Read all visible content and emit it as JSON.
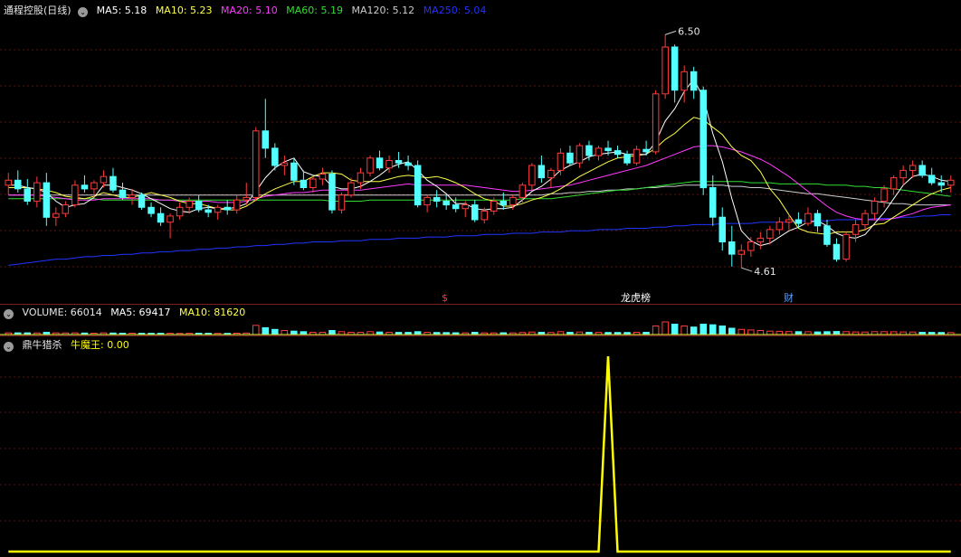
{
  "main_panel": {
    "stock_title": "通程控股(日线)",
    "ma5": "MA5: 5.18",
    "ma10": "MA10: 5.23",
    "ma20": "MA20: 5.10",
    "ma60": "MA60: 5.19",
    "ma120": "MA120: 5.12",
    "ma250": "MA250: 5.04",
    "high_label": "6.50",
    "low_label": "4.61",
    "markers": [
      {
        "text": "$",
        "color": "#ff3b3b"
      },
      {
        "text": "龙虎榜",
        "color": "#ffffff"
      },
      {
        "text": "财",
        "color": "#5aa0ff"
      }
    ]
  },
  "volume_panel": {
    "volume": "VOLUME: 66014",
    "ma5": "MA5: 69417",
    "ma10": "MA10: 81620"
  },
  "indicator_panel": {
    "name": "鼎牛猎杀",
    "line_label": "牛魔王: 0.00"
  },
  "colors": {
    "up": "#ff3b3b",
    "down": "#54ffff",
    "ma5": "#ffffff",
    "ma10": "#ffff4a",
    "ma20": "#ff3bff",
    "ma60": "#33dd33",
    "ma120": "#cccccc",
    "ma250": "#2233ff",
    "indicator": "#ffff00"
  },
  "chart_data": {
    "type": "candlestick",
    "price_range": [
      4.45,
      6.62
    ],
    "ohlc": [
      [
        5.28,
        5.38,
        5.2,
        5.32
      ],
      [
        5.32,
        5.4,
        5.22,
        5.25
      ],
      [
        5.25,
        5.33,
        5.12,
        5.15
      ],
      [
        5.15,
        5.35,
        5.1,
        5.3
      ],
      [
        5.3,
        5.38,
        4.95,
        5.02
      ],
      [
        5.02,
        5.1,
        4.95,
        5.05
      ],
      [
        5.05,
        5.15,
        5.02,
        5.12
      ],
      [
        5.12,
        5.32,
        5.1,
        5.28
      ],
      [
        5.28,
        5.36,
        5.22,
        5.25
      ],
      [
        5.25,
        5.32,
        5.18,
        5.3
      ],
      [
        5.3,
        5.4,
        5.26,
        5.35
      ],
      [
        5.35,
        5.42,
        5.22,
        5.24
      ],
      [
        5.24,
        5.3,
        5.16,
        5.18
      ],
      [
        5.18,
        5.25,
        5.12,
        5.2
      ],
      [
        5.2,
        5.22,
        5.08,
        5.1
      ],
      [
        5.1,
        5.14,
        5.02,
        5.05
      ],
      [
        5.05,
        5.1,
        4.95,
        4.98
      ],
      [
        4.98,
        5.05,
        4.85,
        5.03
      ],
      [
        5.03,
        5.14,
        5.0,
        5.1
      ],
      [
        5.1,
        5.18,
        5.05,
        5.15
      ],
      [
        5.15,
        5.2,
        5.06,
        5.08
      ],
      [
        5.08,
        5.12,
        5.02,
        5.06
      ],
      [
        5.06,
        5.12,
        5.0,
        5.1
      ],
      [
        5.1,
        5.16,
        5.04,
        5.08
      ],
      [
        5.08,
        5.2,
        5.05,
        5.16
      ],
      [
        5.16,
        5.3,
        5.12,
        5.18
      ],
      [
        5.18,
        5.75,
        5.15,
        5.72
      ],
      [
        5.72,
        5.98,
        5.5,
        5.58
      ],
      [
        5.58,
        5.62,
        5.4,
        5.44
      ],
      [
        5.44,
        5.52,
        5.36,
        5.46
      ],
      [
        5.46,
        5.5,
        5.28,
        5.32
      ],
      [
        5.32,
        5.4,
        5.24,
        5.26
      ],
      [
        5.26,
        5.35,
        5.22,
        5.33
      ],
      [
        5.33,
        5.42,
        5.28,
        5.37
      ],
      [
        5.37,
        5.4,
        5.05,
        5.08
      ],
      [
        5.08,
        5.22,
        5.05,
        5.2
      ],
      [
        5.2,
        5.34,
        5.18,
        5.3
      ],
      [
        5.3,
        5.42,
        5.25,
        5.38
      ],
      [
        5.38,
        5.52,
        5.35,
        5.5
      ],
      [
        5.5,
        5.56,
        5.4,
        5.42
      ],
      [
        5.42,
        5.52,
        5.38,
        5.48
      ],
      [
        5.48,
        5.55,
        5.42,
        5.46
      ],
      [
        5.46,
        5.52,
        5.4,
        5.44
      ],
      [
        5.44,
        5.48,
        5.1,
        5.12
      ],
      [
        5.12,
        5.2,
        5.06,
        5.18
      ],
      [
        5.18,
        5.24,
        5.1,
        5.15
      ],
      [
        5.15,
        5.2,
        5.08,
        5.12
      ],
      [
        5.12,
        5.18,
        5.06,
        5.09
      ],
      [
        5.09,
        5.15,
        5.02,
        5.12
      ],
      [
        5.12,
        5.16,
        4.98,
        5.0
      ],
      [
        5.0,
        5.1,
        4.97,
        5.07
      ],
      [
        5.07,
        5.18,
        5.04,
        5.15
      ],
      [
        5.15,
        5.22,
        5.08,
        5.12
      ],
      [
        5.12,
        5.2,
        5.08,
        5.18
      ],
      [
        5.18,
        5.3,
        5.14,
        5.28
      ],
      [
        5.28,
        5.46,
        5.24,
        5.44
      ],
      [
        5.44,
        5.52,
        5.3,
        5.34
      ],
      [
        5.34,
        5.42,
        5.26,
        5.4
      ],
      [
        5.4,
        5.58,
        5.36,
        5.54
      ],
      [
        5.54,
        5.6,
        5.44,
        5.46
      ],
      [
        5.46,
        5.62,
        5.42,
        5.6
      ],
      [
        5.6,
        5.64,
        5.48,
        5.52
      ],
      [
        5.52,
        5.6,
        5.48,
        5.58
      ],
      [
        5.58,
        5.64,
        5.52,
        5.56
      ],
      [
        5.56,
        5.6,
        5.5,
        5.53
      ],
      [
        5.53,
        5.56,
        5.44,
        5.46
      ],
      [
        5.46,
        5.6,
        5.44,
        5.57
      ],
      [
        5.57,
        5.64,
        5.52,
        5.55
      ],
      [
        5.55,
        6.05,
        5.53,
        6.02
      ],
      [
        6.02,
        6.5,
        5.98,
        6.4
      ],
      [
        6.4,
        6.42,
        5.95,
        6.05
      ],
      [
        6.05,
        6.25,
        5.95,
        6.2
      ],
      [
        6.2,
        6.24,
        5.98,
        6.05
      ],
      [
        6.05,
        6.08,
        5.2,
        5.26
      ],
      [
        5.26,
        5.36,
        4.95,
        5.02
      ],
      [
        5.02,
        5.1,
        4.75,
        4.82
      ],
      [
        4.82,
        4.95,
        4.62,
        4.72
      ],
      [
        4.72,
        4.8,
        4.61,
        4.75
      ],
      [
        4.75,
        4.86,
        4.7,
        4.82
      ],
      [
        4.82,
        4.9,
        4.76,
        4.85
      ],
      [
        4.85,
        4.95,
        4.8,
        4.92
      ],
      [
        4.92,
        5.02,
        4.88,
        4.98
      ],
      [
        4.98,
        5.04,
        4.92,
        5.0
      ],
      [
        5.0,
        5.06,
        4.94,
        4.97
      ],
      [
        4.97,
        5.1,
        4.95,
        5.05
      ],
      [
        5.05,
        5.08,
        4.9,
        4.95
      ],
      [
        4.95,
        5.0,
        4.78,
        4.8
      ],
      [
        4.8,
        4.85,
        4.66,
        4.68
      ],
      [
        4.68,
        4.9,
        4.66,
        4.88
      ],
      [
        4.88,
        5.0,
        4.82,
        4.96
      ],
      [
        4.96,
        5.08,
        4.92,
        5.05
      ],
      [
        5.05,
        5.18,
        5.0,
        5.15
      ],
      [
        5.15,
        5.28,
        5.1,
        5.25
      ],
      [
        5.25,
        5.36,
        5.2,
        5.34
      ],
      [
        5.34,
        5.44,
        5.28,
        5.4
      ],
      [
        5.4,
        5.48,
        5.34,
        5.44
      ],
      [
        5.44,
        5.48,
        5.34,
        5.36
      ],
      [
        5.36,
        5.42,
        5.28,
        5.3
      ],
      [
        5.3,
        5.36,
        5.22,
        5.28
      ],
      [
        5.28,
        5.36,
        5.22,
        5.32
      ]
    ],
    "ma5": [
      5.28,
      5.28,
      5.26,
      5.25,
      5.22,
      5.15,
      5.1,
      5.12,
      5.13,
      5.18,
      5.28,
      5.28,
      5.26,
      5.24,
      5.21,
      5.17,
      5.13,
      5.09,
      5.07,
      5.06,
      5.09,
      5.1,
      5.09,
      5.09,
      5.1,
      5.13,
      5.23,
      5.34,
      5.42,
      5.47,
      5.5,
      5.39,
      5.36,
      5.35,
      5.27,
      5.25,
      5.25,
      5.27,
      5.31,
      5.36,
      5.42,
      5.45,
      5.47,
      5.4,
      5.32,
      5.27,
      5.21,
      5.13,
      5.13,
      5.09,
      5.08,
      5.09,
      5.09,
      5.1,
      5.16,
      5.23,
      5.27,
      5.33,
      5.4,
      5.44,
      5.47,
      5.51,
      5.53,
      5.54,
      5.55,
      5.53,
      5.53,
      5.53,
      5.63,
      5.8,
      5.9,
      6.04,
      6.14,
      5.99,
      5.7,
      5.47,
      5.17,
      4.91,
      4.83,
      4.79,
      4.81,
      4.86,
      4.91,
      4.94,
      4.98,
      4.99,
      4.95,
      4.89,
      4.86,
      4.85,
      4.88,
      4.97,
      5.06,
      5.17,
      5.28,
      5.35,
      5.37,
      5.35,
      5.32,
      5.31
    ],
    "ma10": [
      5.26,
      5.26,
      5.26,
      5.25,
      5.24,
      5.22,
      5.19,
      5.18,
      5.17,
      5.19,
      5.22,
      5.2,
      5.18,
      5.18,
      5.2,
      5.22,
      5.2,
      5.18,
      5.15,
      5.13,
      5.13,
      5.11,
      5.09,
      5.08,
      5.08,
      5.11,
      5.16,
      5.21,
      5.25,
      5.28,
      5.31,
      5.31,
      5.35,
      5.38,
      5.38,
      5.37,
      5.32,
      5.31,
      5.31,
      5.31,
      5.33,
      5.35,
      5.36,
      5.35,
      5.34,
      5.35,
      5.33,
      5.3,
      5.26,
      5.21,
      5.17,
      5.15,
      5.11,
      5.11,
      5.13,
      5.16,
      5.18,
      5.21,
      5.25,
      5.3,
      5.35,
      5.39,
      5.43,
      5.47,
      5.5,
      5.51,
      5.52,
      5.53,
      5.58,
      5.65,
      5.7,
      5.77,
      5.83,
      5.81,
      5.75,
      5.69,
      5.59,
      5.52,
      5.48,
      5.39,
      5.25,
      5.16,
      5.04,
      4.93,
      4.9,
      4.89,
      4.88,
      4.9,
      4.9,
      4.9,
      4.92,
      4.96,
      4.97,
      5.02,
      5.07,
      5.12,
      5.17,
      5.21,
      5.24,
      5.26
    ],
    "ma20": [
      5.2,
      5.2,
      5.2,
      5.2,
      5.19,
      5.18,
      5.17,
      5.16,
      5.16,
      5.16,
      5.17,
      5.17,
      5.17,
      5.17,
      5.17,
      5.17,
      5.16,
      5.16,
      5.15,
      5.15,
      5.15,
      5.15,
      5.14,
      5.14,
      5.14,
      5.15,
      5.17,
      5.19,
      5.2,
      5.21,
      5.22,
      5.22,
      5.23,
      5.24,
      5.24,
      5.24,
      5.24,
      5.24,
      5.25,
      5.26,
      5.27,
      5.28,
      5.29,
      5.28,
      5.28,
      5.28,
      5.28,
      5.28,
      5.28,
      5.27,
      5.26,
      5.25,
      5.24,
      5.23,
      5.23,
      5.24,
      5.25,
      5.26,
      5.27,
      5.28,
      5.3,
      5.32,
      5.34,
      5.36,
      5.38,
      5.4,
      5.42,
      5.44,
      5.47,
      5.5,
      5.53,
      5.56,
      5.59,
      5.6,
      5.6,
      5.59,
      5.57,
      5.55,
      5.52,
      5.49,
      5.45,
      5.4,
      5.35,
      5.29,
      5.23,
      5.17,
      5.11,
      5.06,
      5.03,
      5.01,
      5.0,
      5.0,
      5.0,
      5.01,
      5.03,
      5.05,
      5.08,
      5.1,
      5.11,
      5.12
    ],
    "ma60": [
      5.17,
      5.17,
      5.17,
      5.17,
      5.17,
      5.17,
      5.17,
      5.17,
      5.17,
      5.17,
      5.16,
      5.16,
      5.16,
      5.16,
      5.16,
      5.16,
      5.16,
      5.16,
      5.16,
      5.16,
      5.16,
      5.16,
      5.16,
      5.16,
      5.16,
      5.16,
      5.16,
      5.16,
      5.16,
      5.16,
      5.16,
      5.16,
      5.16,
      5.16,
      5.15,
      5.15,
      5.15,
      5.15,
      5.16,
      5.16,
      5.16,
      5.16,
      5.16,
      5.16,
      5.16,
      5.16,
      5.16,
      5.16,
      5.16,
      5.16,
      5.16,
      5.16,
      5.16,
      5.16,
      5.17,
      5.17,
      5.17,
      5.17,
      5.18,
      5.19,
      5.2,
      5.21,
      5.22,
      5.23,
      5.24,
      5.24,
      5.25,
      5.26,
      5.27,
      5.28,
      5.29,
      5.3,
      5.31,
      5.31,
      5.31,
      5.31,
      5.31,
      5.31,
      5.3,
      5.3,
      5.3,
      5.29,
      5.29,
      5.29,
      5.29,
      5.29,
      5.28,
      5.28,
      5.28,
      5.27,
      5.27,
      5.26,
      5.26,
      5.25,
      5.24,
      5.23,
      5.22,
      5.21,
      5.2,
      5.19
    ],
    "ma120": [
      5.2,
      5.2,
      5.2,
      5.2,
      5.2,
      5.2,
      5.2,
      5.2,
      5.2,
      5.2,
      5.2,
      5.2,
      5.2,
      5.2,
      5.2,
      5.2,
      5.2,
      5.2,
      5.2,
      5.2,
      5.2,
      5.2,
      5.2,
      5.2,
      5.2,
      5.2,
      5.2,
      5.2,
      5.2,
      5.2,
      5.2,
      5.2,
      5.2,
      5.2,
      5.2,
      5.2,
      5.2,
      5.2,
      5.2,
      5.2,
      5.2,
      5.2,
      5.2,
      5.2,
      5.2,
      5.2,
      5.2,
      5.2,
      5.2,
      5.2,
      5.2,
      5.2,
      5.2,
      5.2,
      5.2,
      5.2,
      5.2,
      5.21,
      5.21,
      5.22,
      5.22,
      5.23,
      5.23,
      5.24,
      5.24,
      5.25,
      5.25,
      5.26,
      5.26,
      5.27,
      5.27,
      5.28,
      5.28,
      5.28,
      5.28,
      5.28,
      5.27,
      5.27,
      5.26,
      5.26,
      5.25,
      5.24,
      5.23,
      5.22,
      5.21,
      5.21,
      5.2,
      5.19,
      5.18,
      5.17,
      5.16,
      5.15,
      5.14,
      5.13,
      5.13,
      5.12,
      5.12,
      5.12,
      5.12,
      5.12
    ],
    "ma250": [
      4.63,
      4.64,
      4.65,
      4.66,
      4.67,
      4.68,
      4.68,
      4.69,
      4.7,
      4.7,
      4.71,
      4.71,
      4.72,
      4.72,
      4.73,
      4.73,
      4.74,
      4.74,
      4.75,
      4.75,
      4.76,
      4.76,
      4.77,
      4.77,
      4.78,
      4.78,
      4.79,
      4.79,
      4.8,
      4.8,
      4.81,
      4.81,
      4.82,
      4.82,
      4.82,
      4.83,
      4.83,
      4.83,
      4.84,
      4.84,
      4.84,
      4.85,
      4.85,
      4.85,
      4.86,
      4.86,
      4.86,
      4.87,
      4.87,
      4.87,
      4.88,
      4.88,
      4.88,
      4.89,
      4.89,
      4.89,
      4.9,
      4.9,
      4.9,
      4.91,
      4.91,
      4.91,
      4.92,
      4.92,
      4.92,
      4.93,
      4.93,
      4.93,
      4.94,
      4.94,
      4.95,
      4.95,
      4.96,
      4.96,
      4.96,
      4.97,
      4.97,
      4.97,
      4.97,
      4.98,
      4.98,
      4.98,
      4.98,
      4.99,
      4.99,
      4.99,
      4.99,
      5.0,
      5.0,
      5.0,
      5.0,
      5.01,
      5.01,
      5.01,
      5.02,
      5.02,
      5.03,
      5.03,
      5.04,
      5.04
    ],
    "volume": [
      30,
      30,
      30,
      28,
      40,
      30,
      28,
      30,
      26,
      24,
      30,
      26,
      24,
      24,
      22,
      22,
      22,
      22,
      20,
      22,
      24,
      22,
      20,
      20,
      24,
      26,
      160,
      120,
      90,
      70,
      60,
      50,
      40,
      40,
      70,
      50,
      40,
      40,
      50,
      44,
      40,
      38,
      38,
      50,
      40,
      36,
      34,
      32,
      30,
      40,
      30,
      30,
      32,
      30,
      36,
      44,
      40,
      36,
      50,
      40,
      44,
      40,
      38,
      36,
      36,
      36,
      40,
      40,
      150,
      220,
      180,
      150,
      130,
      180,
      170,
      150,
      110,
      90,
      80,
      70,
      60,
      56,
      52,
      50,
      48,
      46,
      50,
      54,
      50,
      46,
      44,
      50,
      50,
      48,
      46,
      44,
      40,
      38,
      36,
      34
    ],
    "indicator": [
      0,
      0,
      0,
      0,
      0,
      0,
      0,
      0,
      0,
      0,
      0,
      0,
      0,
      0,
      0,
      0,
      0,
      0,
      0,
      0,
      0,
      0,
      0,
      0,
      0,
      0,
      0,
      0,
      0,
      0,
      0,
      0,
      0,
      0,
      0,
      0,
      0,
      0,
      0,
      0,
      0,
      0,
      0,
      0,
      0,
      0,
      0,
      0,
      0,
      0,
      0,
      0,
      0,
      0,
      0,
      0,
      0,
      0,
      0,
      0,
      0,
      0,
      0,
      1,
      0,
      0,
      0,
      0,
      0,
      0,
      0,
      0,
      0,
      0,
      0,
      0,
      0,
      0,
      0,
      0,
      0,
      0,
      0,
      0,
      0,
      0,
      0,
      0,
      0,
      0,
      0,
      0,
      0,
      0,
      0,
      0,
      0,
      0,
      0,
      0
    ]
  }
}
